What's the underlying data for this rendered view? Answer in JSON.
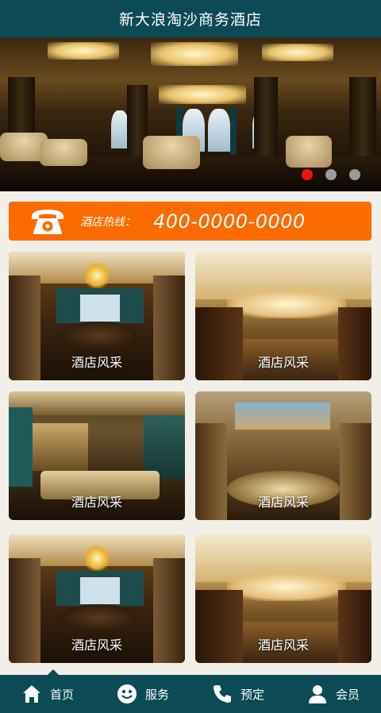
{
  "header": {
    "title": "新大浪淘沙商务酒店"
  },
  "banner": {
    "icon": "hotel-lobby-photo",
    "slides": 3,
    "active_slide": 1,
    "accent": "#ee1111"
  },
  "hotline": {
    "icon": "telephone-icon",
    "label": "酒店热线：",
    "number": "400-0000-0000",
    "color": "#fb6b00"
  },
  "gallery": {
    "items": [
      {
        "caption": "酒店风采",
        "scene": "dining-room"
      },
      {
        "caption": "酒店风采",
        "scene": "lobby-chandelier"
      },
      {
        "caption": "酒店风采",
        "scene": "lounge"
      },
      {
        "caption": "酒店风采",
        "scene": "grand-hall"
      },
      {
        "caption": "酒店风采",
        "scene": "dining-room"
      },
      {
        "caption": "酒店风采",
        "scene": "lobby-chandelier"
      }
    ]
  },
  "tabbar": {
    "color": "#0c4a55",
    "tabs": [
      {
        "label": "首页",
        "icon": "home-icon",
        "active": true
      },
      {
        "label": "服务",
        "icon": "smiley-icon",
        "active": false
      },
      {
        "label": "预定",
        "icon": "phone-icon",
        "active": false
      },
      {
        "label": "会员",
        "icon": "user-icon",
        "active": false
      }
    ]
  }
}
